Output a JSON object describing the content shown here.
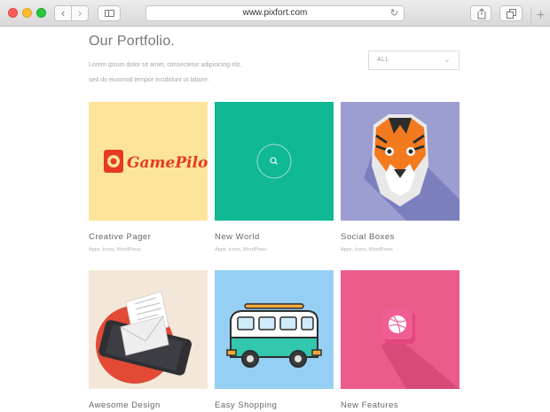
{
  "browser": {
    "url": "www.pixfort.com"
  },
  "header": {
    "title": "Our Portfolio.",
    "description_line1": "Lorem ipsum dolor sit amet, consectetur adipisicing elit,",
    "description_line2": "sed do eiusmod tempor incididunt ut labore."
  },
  "filter": {
    "selected": "ALL"
  },
  "projects": [
    {
      "title": "Creative Pager",
      "tags": "Apps, Icons, WordPress",
      "logo_text": "GamePilot",
      "bg": "#fde49b"
    },
    {
      "title": "New World",
      "tags": "Apps, Icons, WordPress",
      "bg": "#10b894"
    },
    {
      "title": "Social Boxes",
      "tags": "Apps, Icons, WordPress",
      "bg": "#9c9ed1"
    },
    {
      "title": "Awesome Design",
      "bg": "#f2e7d8"
    },
    {
      "title": "Easy Shopping",
      "bg": "#96cff4"
    },
    {
      "title": "New Features",
      "bg": "#ec5c8b"
    }
  ],
  "colors": {
    "accent_red": "#e63b1f",
    "dribbble_pink": "#ea4c89"
  },
  "icons": [
    "back-icon",
    "forward-icon",
    "sidebar-icon",
    "reload-icon",
    "share-icon",
    "tabs-icon",
    "plus-icon",
    "search-icon",
    "chevron-down-icon",
    "dribbble-icon"
  ]
}
